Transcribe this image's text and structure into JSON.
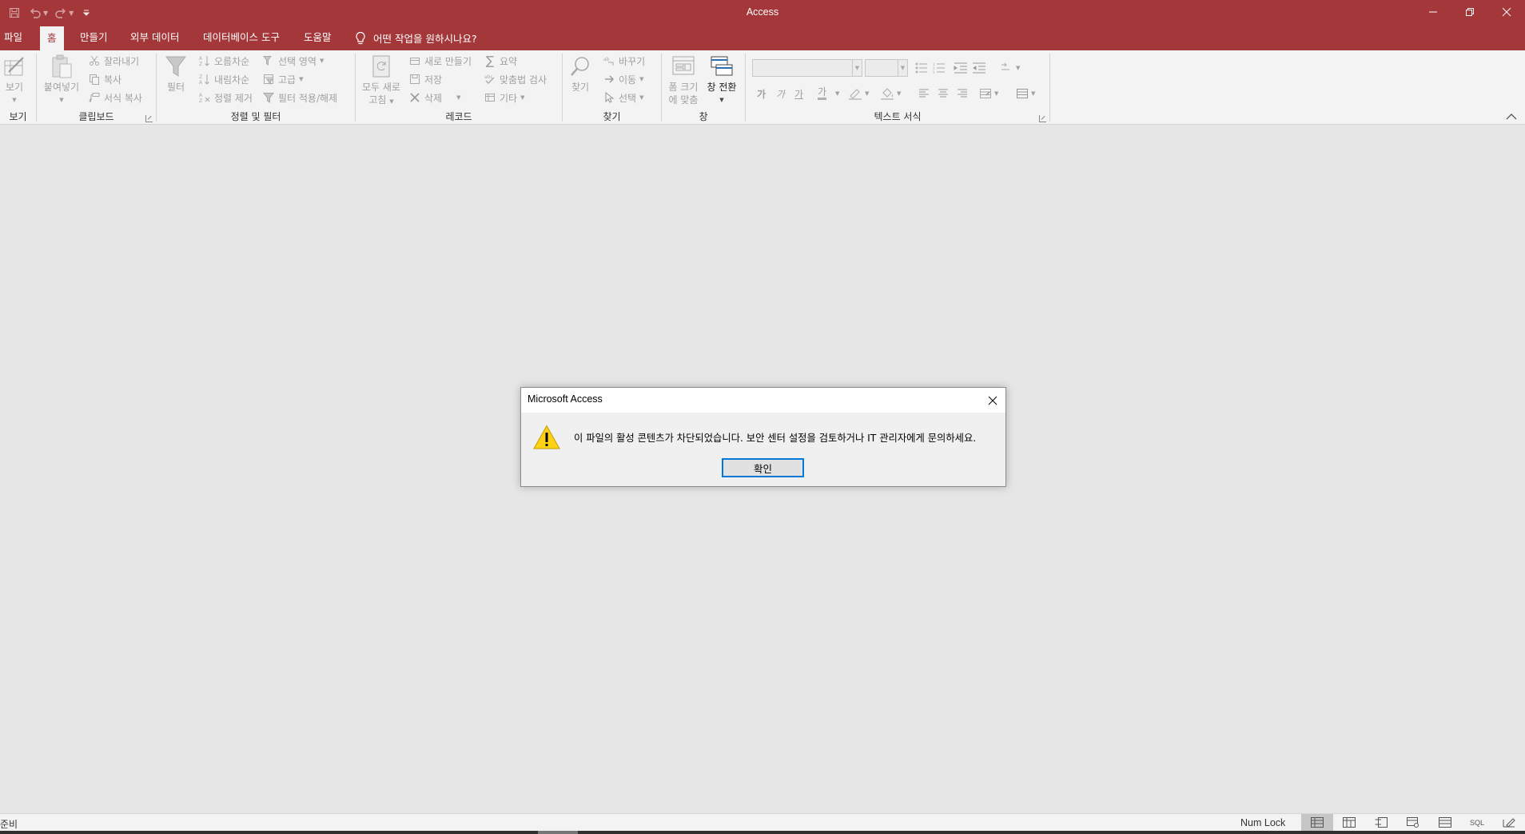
{
  "app": {
    "title": "Access"
  },
  "tabs": [
    {
      "label": "파일"
    },
    {
      "label": "홈"
    },
    {
      "label": "만들기"
    },
    {
      "label": "외부 데이터"
    },
    {
      "label": "데이터베이스 도구"
    },
    {
      "label": "도움말"
    }
  ],
  "tell_me": {
    "placeholder": "어떤 작업을 원하시나요?"
  },
  "ribbon": {
    "groups": {
      "view": "보기",
      "clipboard": "클립보드",
      "sort_filter": "정렬 및 필터",
      "records": "레코드",
      "find": "찾기",
      "window": "창",
      "text_format": "텍스트 서식"
    },
    "buttons": {
      "view": "보기",
      "paste": "붙여넣기",
      "cut": "잘라내기",
      "copy": "복사",
      "format_painter": "서식 복사",
      "filter": "필터",
      "ascending": "오름차순",
      "descending": "내림차순",
      "remove_sort": "정렬 제거",
      "selection": "선택 영역",
      "advanced": "고급",
      "toggle_filter": "필터 적용/해제",
      "refresh_line1": "모두 새로",
      "refresh_line2": "고침",
      "new": "새로 만들기",
      "save": "저장",
      "delete": "삭제",
      "totals": "요약",
      "spelling": "맞춤법 검사",
      "more": "기타",
      "find": "찾기",
      "replace": "바꾸기",
      "goto": "이동",
      "select": "선택",
      "fit_line1": "폼 크기",
      "fit_line2": "에 맞춤",
      "switch_windows": "창 전환",
      "font_style_1": "가",
      "font_style_2": "가",
      "font_style_3": "가",
      "font_color": "가"
    }
  },
  "dialog": {
    "title": "Microsoft Access",
    "message": "이 파일의 활성 콘텐츠가 차단되었습니다. 보안 센터 설정을 검토하거나 IT 관리자에게 문의하세요.",
    "ok": "확인"
  },
  "status": {
    "text": "준비",
    "num_lock": "Num Lock",
    "sql": "SQL"
  }
}
